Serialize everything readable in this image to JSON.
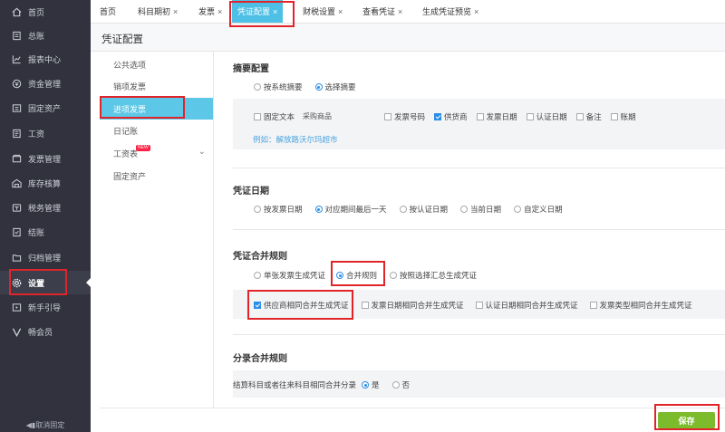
{
  "sidebar": {
    "items": [
      {
        "label": "首页",
        "icon": "home-icon"
      },
      {
        "label": "总账",
        "icon": "ledger-icon"
      },
      {
        "label": "报表中心",
        "icon": "chart-icon"
      },
      {
        "label": "资金管理",
        "icon": "money-icon"
      },
      {
        "label": "固定资产",
        "icon": "asset-icon"
      },
      {
        "label": "工资",
        "icon": "salary-icon"
      },
      {
        "label": "发票管理",
        "icon": "invoice-icon"
      },
      {
        "label": "库存核算",
        "icon": "warehouse-icon"
      },
      {
        "label": "税务管理",
        "icon": "tax-icon"
      },
      {
        "label": "结账",
        "icon": "checkout-icon"
      },
      {
        "label": "归档管理",
        "icon": "archive-icon"
      },
      {
        "label": "设置",
        "icon": "gear-icon"
      },
      {
        "label": "新手引导",
        "icon": "guide-icon"
      },
      {
        "label": "畅会员",
        "icon": "vip-icon"
      }
    ],
    "active_label": "设置",
    "cancel_pin": "◀▮取消固定"
  },
  "tabs": [
    {
      "label": "首页",
      "closable": false
    },
    {
      "label": "科目期初",
      "closable": true
    },
    {
      "label": "发票",
      "closable": true
    },
    {
      "label": "凭证配置",
      "closable": true,
      "active": true
    },
    {
      "label": "财税设置",
      "closable": true
    },
    {
      "label": "查看凭证",
      "closable": true
    },
    {
      "label": "生成凭证预览",
      "closable": true
    }
  ],
  "tab_close": "×",
  "page_title": "凭证配置",
  "left_menu": [
    {
      "label": "公共选项"
    },
    {
      "label": "销项发票"
    },
    {
      "label": "进项发票",
      "active": true
    },
    {
      "label": "日记账"
    },
    {
      "label": "工资表",
      "badge": "NEW",
      "expand": "⌄"
    },
    {
      "label": "固定资产"
    }
  ],
  "summary": {
    "title": "摘要配置",
    "options": [
      "按系统摘要",
      "选择摘要"
    ],
    "selected": "选择摘要",
    "fixed_text_label": "固定文本",
    "fixed_text_value": "采购商品",
    "checkboxes": [
      {
        "label": "发票号码",
        "checked": false
      },
      {
        "label": "供货商",
        "checked": true
      },
      {
        "label": "发票日期",
        "checked": false
      },
      {
        "label": "认证日期",
        "checked": false
      },
      {
        "label": "备注",
        "checked": false
      },
      {
        "label": "账期",
        "checked": false
      }
    ],
    "example": "例如：解放路沃尔玛超市"
  },
  "voucher_date": {
    "title": "凭证日期",
    "options": [
      "按发票日期",
      "对应期间最后一天",
      "按认证日期",
      "当前日期",
      "自定义日期"
    ],
    "selected": "对应期间最后一天"
  },
  "merge_rule": {
    "title": "凭证合并规则",
    "options": [
      "单张发票生成凭证",
      "合并规则",
      "按照选择汇总生成凭证"
    ],
    "selected": "合并规则",
    "checkboxes": [
      {
        "label": "供应商相同合并生成凭证",
        "checked": true
      },
      {
        "label": "发票日期相同合并生成凭证",
        "checked": false
      },
      {
        "label": "认证日期相同合并生成凭证",
        "checked": false
      },
      {
        "label": "发票类型相同合并生成凭证",
        "checked": false
      }
    ]
  },
  "entry_merge": {
    "title": "分录合并规则",
    "question": "结算科目或者往来科目相同合并分录",
    "options": [
      "是",
      "否"
    ],
    "selected": "是"
  },
  "save_label": "保存",
  "colors": {
    "sidebar_bg": "#31323d",
    "active_tab": "#4ec0e6",
    "save_btn": "#7cbb2b",
    "highlight": "#e0242a"
  }
}
